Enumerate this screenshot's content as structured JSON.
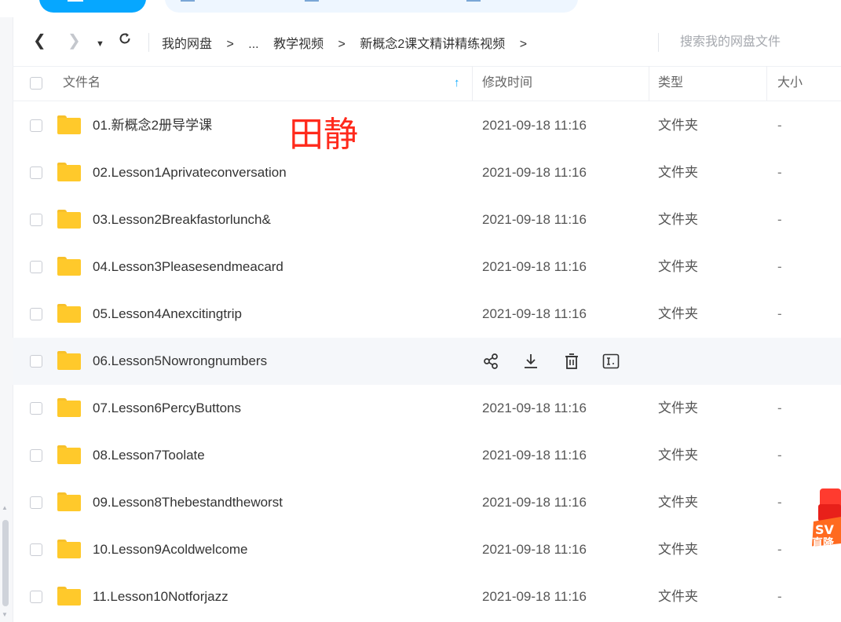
{
  "nav": {
    "breadcrumb": [
      "我的网盘",
      "...",
      "教学视频",
      "新概念2课文精讲精练视频"
    ],
    "separator": ">",
    "search_placeholder": "搜索我的网盘文件"
  },
  "table": {
    "columns": {
      "name": "文件名",
      "modified": "修改时间",
      "type": "类型",
      "size": "大小"
    },
    "sort": "ascending"
  },
  "files": [
    {
      "name": "01.新概念2册导学课",
      "modified": "2021-09-18 11:16",
      "type": "文件夹",
      "size": "-"
    },
    {
      "name": "02.Lesson1Aprivateconversation",
      "modified": "2021-09-18 11:16",
      "type": "文件夹",
      "size": "-"
    },
    {
      "name": "03.Lesson2Breakfastorlunch&",
      "modified": "2021-09-18 11:16",
      "type": "文件夹",
      "size": "-"
    },
    {
      "name": "04.Lesson3Pleasesendmeacard",
      "modified": "2021-09-18 11:16",
      "type": "文件夹",
      "size": "-"
    },
    {
      "name": "05.Lesson4Anexcitingtrip",
      "modified": "2021-09-18 11:16",
      "type": "文件夹",
      "size": "-"
    },
    {
      "name": "06.Lesson5Nowrongnumbers",
      "hovered": true
    },
    {
      "name": "07.Lesson6PercyButtons",
      "modified": "2021-09-18 11:16",
      "type": "文件夹",
      "size": "-"
    },
    {
      "name": "08.Lesson7Toolate",
      "modified": "2021-09-18 11:16",
      "type": "文件夹",
      "size": "-"
    },
    {
      "name": "09.Lesson8Thebestandtheworst",
      "modified": "2021-09-18 11:16",
      "type": "文件夹",
      "size": "-"
    },
    {
      "name": "10.Lesson9Acoldwelcome",
      "modified": "2021-09-18 11:16",
      "type": "文件夹",
      "size": "-"
    },
    {
      "name": "11.Lesson10Notforjazz",
      "modified": "2021-09-18 11:16",
      "type": "文件夹",
      "size": "-"
    }
  ],
  "row_actions": [
    "share-icon",
    "download-icon",
    "delete-icon",
    "rename-icon"
  ],
  "watermark": "田静",
  "promo": {
    "text_1": "SV",
    "text_2": "直降"
  },
  "colors": {
    "accent": "#06a7ff",
    "folder": "#ffc92b",
    "watermark": "#ff2a1c",
    "hover_row": "#f5f7fa"
  }
}
